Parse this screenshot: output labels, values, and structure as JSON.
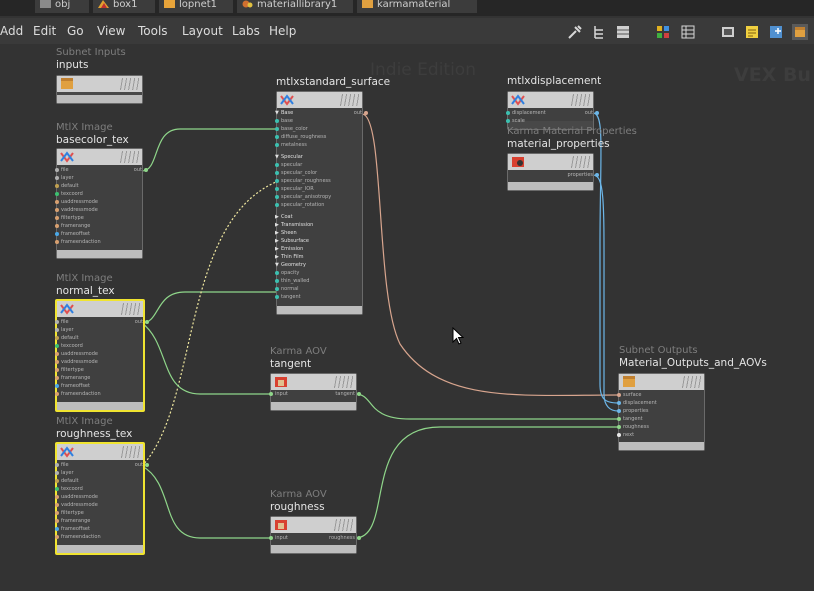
{
  "pathbar": {
    "items": [
      {
        "label": "obj",
        "icon": "obj-icon"
      },
      {
        "label": "box1",
        "icon": "box-icon"
      },
      {
        "label": "lopnet1",
        "icon": "lop-icon"
      },
      {
        "label": "materiallibrary1",
        "icon": "material-library-icon"
      },
      {
        "label": "karmamaterial",
        "icon": "karma-material-icon"
      }
    ]
  },
  "menubar": {
    "items": [
      "Add",
      "Edit",
      "Go",
      "View",
      "Tools",
      "Layout",
      "Labs",
      "Help"
    ],
    "tools": [
      "wrench-icon",
      "tree-icon",
      "list-icon",
      "grid-icon",
      "table-icon",
      "image-icon",
      "note-icon",
      "image-add-icon",
      "box-icon"
    ]
  },
  "watermarks": {
    "edition": "Indie Edition",
    "context": "VEX Bu"
  },
  "colors": {
    "background": "#333333",
    "selected": "#f0e430",
    "wire": "#8fd68a",
    "wire_surface": "#d8a58e",
    "wire_properties": "#6cb6e8"
  },
  "nodes": {
    "inputs": {
      "type": "Subnet Inputs",
      "name": "inputs"
    },
    "basecolor": {
      "type": "MtlX Image",
      "name": "basecolor_tex",
      "out": "out",
      "ports": [
        "file",
        "layer",
        "default",
        "texcoord",
        "uaddressmode",
        "vaddressmode",
        "filtertype",
        "framerange",
        "frameoffset",
        "frameendaction"
      ]
    },
    "normal": {
      "type": "MtlX Image",
      "name": "normal_tex",
      "out": "out",
      "ports": [
        "file",
        "layer",
        "default",
        "texcoord",
        "uaddressmode",
        "vaddressmode",
        "filtertype",
        "framerange",
        "frameoffset",
        "frameendaction"
      ]
    },
    "roughness": {
      "type": "MtlX Image",
      "name": "roughness_tex",
      "out": "out",
      "ports": [
        "file",
        "layer",
        "default",
        "texcoord",
        "uaddressmode",
        "vaddressmode",
        "filtertype",
        "framerange",
        "frameoffset",
        "frameendaction"
      ]
    },
    "surface": {
      "name": "mtlxstandard_surface",
      "out": "out",
      "rows": [
        {
          "kind": "sect",
          "label": "Base",
          "open": true
        },
        {
          "kind": "port",
          "label": "base"
        },
        {
          "kind": "port",
          "label": "base_color"
        },
        {
          "kind": "port",
          "label": "diffuse_roughness"
        },
        {
          "kind": "port",
          "label": "metalness"
        },
        {
          "kind": "gap"
        },
        {
          "kind": "sect",
          "label": "Specular",
          "open": true
        },
        {
          "kind": "port",
          "label": "specular"
        },
        {
          "kind": "port",
          "label": "specular_color"
        },
        {
          "kind": "port",
          "label": "specular_roughness"
        },
        {
          "kind": "port",
          "label": "specular_IOR"
        },
        {
          "kind": "port",
          "label": "specular_anisotropy"
        },
        {
          "kind": "port",
          "label": "specular_rotation"
        },
        {
          "kind": "gap"
        },
        {
          "kind": "sect",
          "label": "Coat",
          "open": false
        },
        {
          "kind": "sect",
          "label": "Transmission",
          "open": false
        },
        {
          "kind": "sect",
          "label": "Sheen",
          "open": false
        },
        {
          "kind": "sect",
          "label": "Subsurface",
          "open": false
        },
        {
          "kind": "sect",
          "label": "Emission",
          "open": false
        },
        {
          "kind": "sect",
          "label": "Thin Film",
          "open": false
        },
        {
          "kind": "sect",
          "label": "Geometry",
          "open": true
        },
        {
          "kind": "port",
          "label": "opacity"
        },
        {
          "kind": "port",
          "label": "thin_walled"
        },
        {
          "kind": "port",
          "label": "normal"
        },
        {
          "kind": "port",
          "label": "tangent"
        }
      ]
    },
    "displacement": {
      "name": "mtlxdisplacement",
      "out": "out",
      "ports": [
        "displacement",
        "scale"
      ]
    },
    "properties": {
      "type": "Karma Material Properties",
      "name": "material_properties",
      "out": "properties"
    },
    "aov_tangent": {
      "type": "Karma AOV",
      "name": "tangent",
      "in": "input",
      "out": "tangent"
    },
    "aov_roughness": {
      "type": "Karma AOV",
      "name": "roughness",
      "in": "input",
      "out": "roughness"
    },
    "outputs": {
      "type": "Subnet Outputs",
      "name": "Material_Outputs_and_AOVs",
      "ports": [
        "surface",
        "displacement",
        "properties",
        "tangent",
        "roughness",
        "next"
      ]
    }
  }
}
